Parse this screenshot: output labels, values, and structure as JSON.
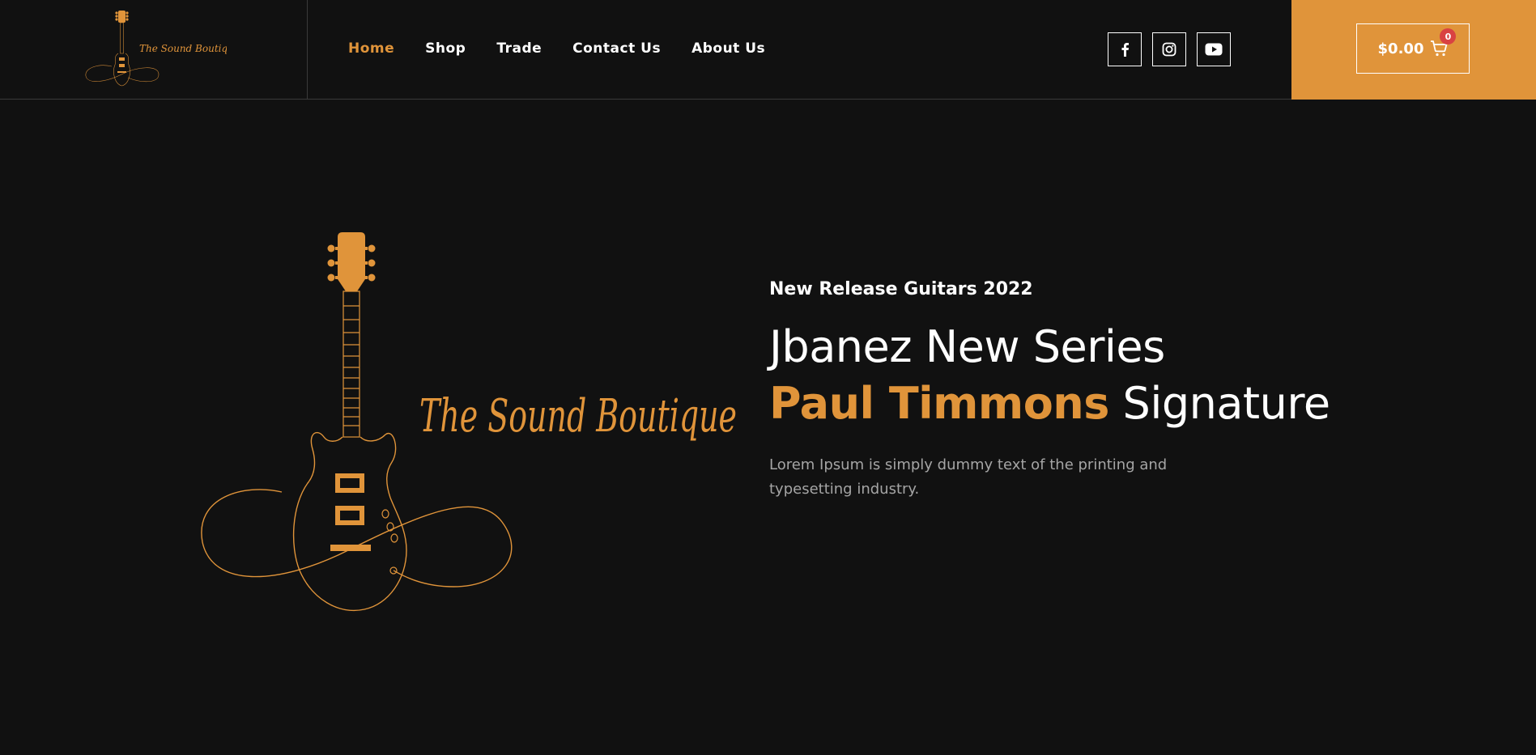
{
  "brand": {
    "name": "The Sound Boutique",
    "accent_color": "#e0943a",
    "background_color": "#111111"
  },
  "nav": {
    "items": [
      {
        "label": "Home",
        "active": true
      },
      {
        "label": "Shop",
        "active": false
      },
      {
        "label": "Trade",
        "active": false
      },
      {
        "label": "Contact Us",
        "active": false
      },
      {
        "label": "About Us",
        "active": false
      }
    ]
  },
  "socials": [
    {
      "icon": "facebook-icon"
    },
    {
      "icon": "instagram-icon"
    },
    {
      "icon": "youtube-icon"
    }
  ],
  "cart": {
    "amount": "$0.00",
    "count": "0",
    "icon": "cart-icon"
  },
  "hero": {
    "eyebrow": "New Release Guitars 2022",
    "headline_line1": "Jbanez New Series",
    "headline_accent": "Paul Timmons",
    "headline_rest": " Signature",
    "lead": "Lorem Ipsum is simply dummy text of the printing and typesetting industry."
  }
}
